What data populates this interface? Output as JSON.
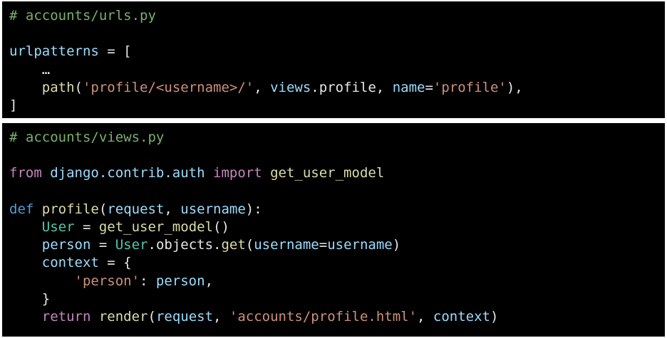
{
  "urls_panel": {
    "comment": "# accounts/urls.py",
    "l1_var": "urlpatterns",
    "l1_rest": " = [",
    "l2_ellipsis": "…",
    "l3_fn": "path",
    "l3_open": "(",
    "l3_str": "'profile/<username>/'",
    "l3_comma1": ", ",
    "l3_mod": "views",
    "l3_attr": ".profile, ",
    "l3_kw": "name",
    "l3_eq": "=",
    "l3_str2": "'profile'",
    "l3_close": "),",
    "l4_close": "]"
  },
  "views_panel": {
    "comment": "# accounts/views.py",
    "import_from": "from",
    "import_module": "django.contrib.auth",
    "import_kw": "import",
    "import_name": "get_user_model",
    "def_kw": "def",
    "def_name": "profile",
    "def_open": "(",
    "def_param1": "request",
    "def_comma": ", ",
    "def_param2": "username",
    "def_close": "):",
    "user_cls": "User",
    "user_eq": " = ",
    "user_fn": "get_user_model",
    "user_call": "()",
    "person_var": "person",
    "person_eq": " = ",
    "person_cls": "User",
    "person_objects": ".objects.",
    "person_get": "get",
    "person_open": "(",
    "person_kw": "username",
    "person_eq2": "=",
    "person_arg": "username",
    "person_close": ")",
    "context_var": "context",
    "context_eq": " = {",
    "dict_key": "'person'",
    "dict_colon": ": ",
    "dict_val": "person",
    "dict_comma": ",",
    "dict_close": "}",
    "return_kw": "return",
    "return_fn": "render",
    "return_open": "(",
    "return_arg1": "request",
    "return_comma1": ", ",
    "return_str": "'accounts/profile.html'",
    "return_comma2": ", ",
    "return_arg3": "context",
    "return_close": ")"
  }
}
